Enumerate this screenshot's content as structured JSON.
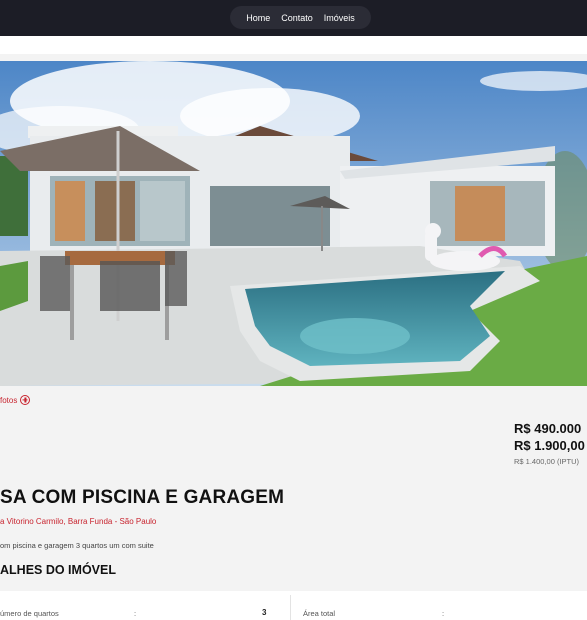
{
  "nav": {
    "items": [
      "Home",
      "Contato",
      "Imóveis"
    ]
  },
  "gallery": {
    "photos_link": "fotos",
    "image_alt": "casa com piscina"
  },
  "prices": {
    "sale": "R$ 490.000",
    "rent": "R$ 1.900,00",
    "iptu": "R$ 1.400,00 (IPTU)"
  },
  "listing": {
    "title": "SA COM PISCINA E GARAGEM",
    "address": "a Vitorino Carmilo, Barra Funda - São Paulo",
    "description": "om piscina e garagem 3 quartos um com suite",
    "details_title": "ALHES DO IMÓVEL"
  },
  "details": [
    {
      "label": "úmero de quartos",
      "value": "3"
    },
    {
      "label": "Área total",
      "value": ""
    }
  ],
  "colors": {
    "accent": "#c8242f",
    "topbar": "#1c1d26",
    "background": "#f3f3f3"
  }
}
